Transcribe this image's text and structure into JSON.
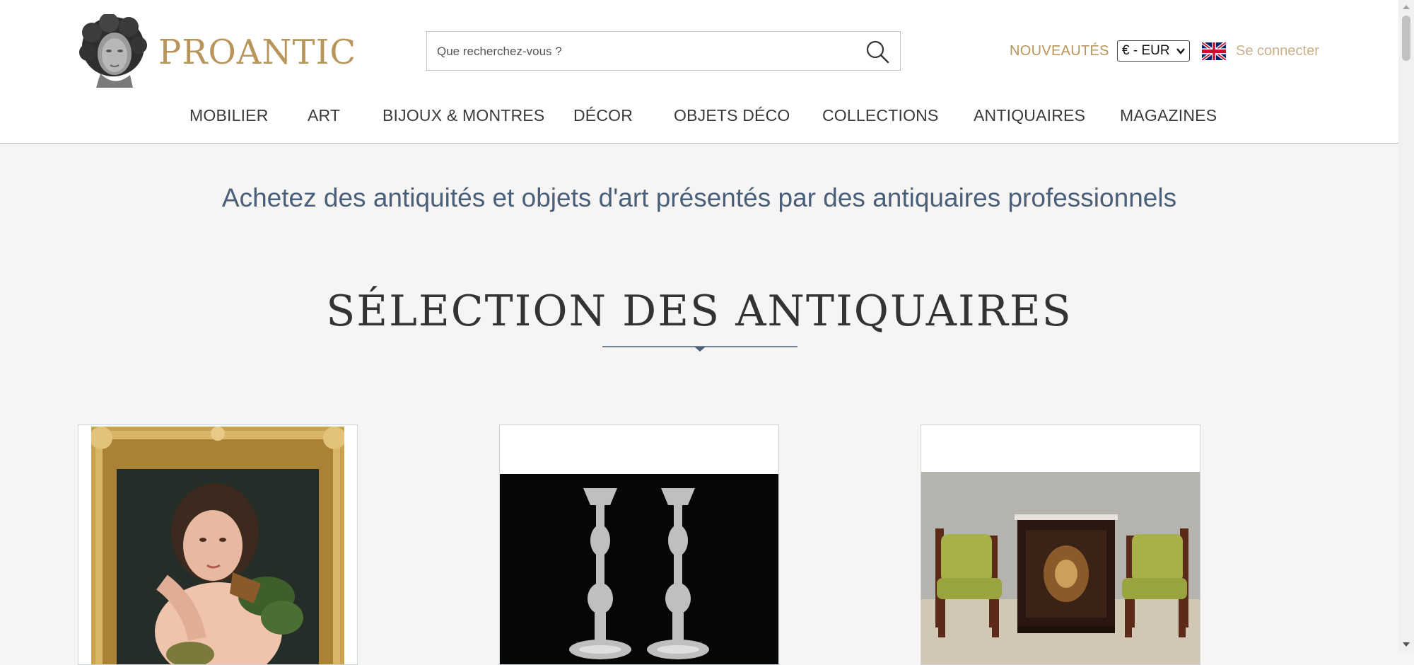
{
  "header": {
    "logo_text": "PROANTIC",
    "search": {
      "placeholder": "Que recherchez-vous ?"
    },
    "nouveautes_label": "NOUVEAUTÉS",
    "currency_selected": "€ - EUR",
    "login_label": "Se connecter"
  },
  "nav": {
    "items": [
      {
        "label": "MOBILIER"
      },
      {
        "label": "ART"
      },
      {
        "label": "BIJOUX & MONTRES"
      },
      {
        "label": "DÉCOR"
      },
      {
        "label": "OBJETS DÉCO"
      },
      {
        "label": "COLLECTIONS"
      },
      {
        "label": "ANTIQUAIRES"
      },
      {
        "label": "MAGAZINES"
      }
    ]
  },
  "main": {
    "tagline": "Achetez des antiquités et objets d'art présentés par des antiquaires professionnels",
    "section_title": "SÉLECTION DES ANTIQUAIRES"
  },
  "colors": {
    "brand_gold": "#b8955a",
    "tagline_blue": "#4a5f7a",
    "page_bg": "#f6f5f3"
  },
  "icons": [
    "logo-bust-icon",
    "search-icon",
    "uk-flag-icon",
    "chevron-down-icon"
  ]
}
